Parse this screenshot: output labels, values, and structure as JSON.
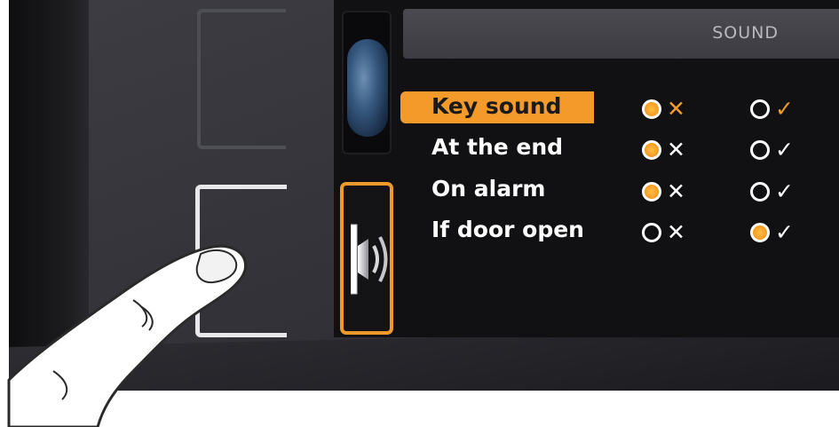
{
  "screen": {
    "title": "SOUND",
    "accent_color": "#f39a2a",
    "tiles": [
      {
        "name": "globe-tile",
        "icon": "globe-icon",
        "selected": false
      },
      {
        "name": "sound-tile",
        "icon": "speaker-icon",
        "selected": true
      }
    ]
  },
  "settings": [
    {
      "label": "Key sound",
      "off_glyph": "✕",
      "on_glyph": "✓",
      "selected": "off",
      "highlighted": true
    },
    {
      "label": "At the end",
      "off_glyph": "✕",
      "on_glyph": "✓",
      "selected": "off",
      "highlighted": false
    },
    {
      "label": "On alarm",
      "off_glyph": "✕",
      "on_glyph": "✓",
      "selected": "off",
      "highlighted": false
    },
    {
      "label": "If door open",
      "off_glyph": "✕",
      "on_glyph": "✓",
      "selected": "on",
      "highlighted": false
    }
  ]
}
